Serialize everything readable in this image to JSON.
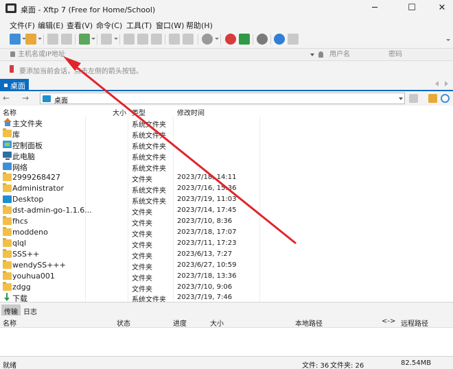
{
  "window": {
    "title": "桌面 - Xftp 7 (Free for Home/School)",
    "minimize_glyph": "─",
    "maximize_glyph": "☐",
    "close_glyph": "✕"
  },
  "menu": {
    "items": [
      "文件(F)",
      "编辑(E)",
      "查看(V)",
      "命令(C)",
      "工具(T)",
      "窗口(W)",
      "帮助(H)"
    ]
  },
  "toolbar": {
    "icons": [
      "new-session-icon",
      "open-folder-icon",
      "connect-icon",
      "disconnect-icon",
      "new-file-icon",
      "transfer-icon",
      "properties-icon",
      "copy-icon",
      "paste-icon",
      "rename-icon",
      "sync-icon",
      "globe-icon",
      "xshell-icon",
      "xftp-icon",
      "settings-icon",
      "help-icon",
      "chat-icon"
    ]
  },
  "address": {
    "host_placeholder": "主机名或IP地址",
    "user_placeholder": "用户名",
    "password_placeholder": "密码"
  },
  "hint": {
    "text": "要添加当前会话，点击左侧的箭头按钮。"
  },
  "tabs": {
    "active_label": "桌面"
  },
  "path": {
    "current": "桌面",
    "back_glyph": "←",
    "forward_glyph": "→"
  },
  "filelist": {
    "columns": {
      "name": "名称",
      "size": "大小",
      "type": "类型",
      "modified": "修改时间"
    },
    "rows": [
      {
        "name": "主文件夹",
        "type": "系统文件夹",
        "modified": "",
        "icon": "home-icon"
      },
      {
        "name": "库",
        "type": "系统文件夹",
        "modified": "",
        "icon": "folder-icon"
      },
      {
        "name": "控制面板",
        "type": "系统文件夹",
        "modified": "",
        "icon": "control-panel-icon"
      },
      {
        "name": "此电脑",
        "type": "系统文件夹",
        "modified": "",
        "icon": "computer-icon"
      },
      {
        "name": "网络",
        "type": "系统文件夹",
        "modified": "",
        "icon": "network-icon"
      },
      {
        "name": "2999268427",
        "type": "文件夹",
        "modified": "2023/7/18, 14:11",
        "icon": "folder-icon"
      },
      {
        "name": "Administrator",
        "type": "系统文件夹",
        "modified": "2023/7/16, 15:36",
        "icon": "folder-icon"
      },
      {
        "name": "Desktop",
        "type": "系统文件夹",
        "modified": "2023/7/19, 11:03",
        "icon": "desktop-icon"
      },
      {
        "name": "dst-admin-go-1.1.6...",
        "type": "文件夹",
        "modified": "2023/7/14, 17:45",
        "icon": "folder-icon"
      },
      {
        "name": "fhcs",
        "type": "文件夹",
        "modified": "2023/7/10, 8:36",
        "icon": "folder-icon"
      },
      {
        "name": "moddeno",
        "type": "文件夹",
        "modified": "2023/7/18, 17:07",
        "icon": "folder-icon"
      },
      {
        "name": "qlql",
        "type": "文件夹",
        "modified": "2023/7/11, 17:23",
        "icon": "folder-icon"
      },
      {
        "name": "SSS++",
        "type": "文件夹",
        "modified": "2023/6/13, 7:27",
        "icon": "folder-icon"
      },
      {
        "name": "wendySS+++",
        "type": "文件夹",
        "modified": "2023/6/27, 10:59",
        "icon": "folder-icon"
      },
      {
        "name": "youhua001",
        "type": "文件夹",
        "modified": "2023/7/18, 13:36",
        "icon": "folder-icon"
      },
      {
        "name": "zdgg",
        "type": "文件夹",
        "modified": "2023/7/10, 9:06",
        "icon": "folder-icon"
      },
      {
        "name": "下载",
        "type": "系统文件夹",
        "modified": "2023/7/19, 7:46",
        "icon": "download-icon"
      }
    ]
  },
  "transfer": {
    "tabs": [
      "传输",
      "日志"
    ],
    "columns": [
      "名称",
      "状态",
      "进度",
      "大小",
      "本地路径",
      "<->",
      "远程路径"
    ]
  },
  "status": {
    "left": "就绪",
    "files": "文件: 36",
    "folders": "文件夹: 26",
    "size": "82.54MB"
  },
  "colors": {
    "accent": "#0a6cc1",
    "annotation_arrow": "#e0242a",
    "folder": "#f2c048"
  }
}
